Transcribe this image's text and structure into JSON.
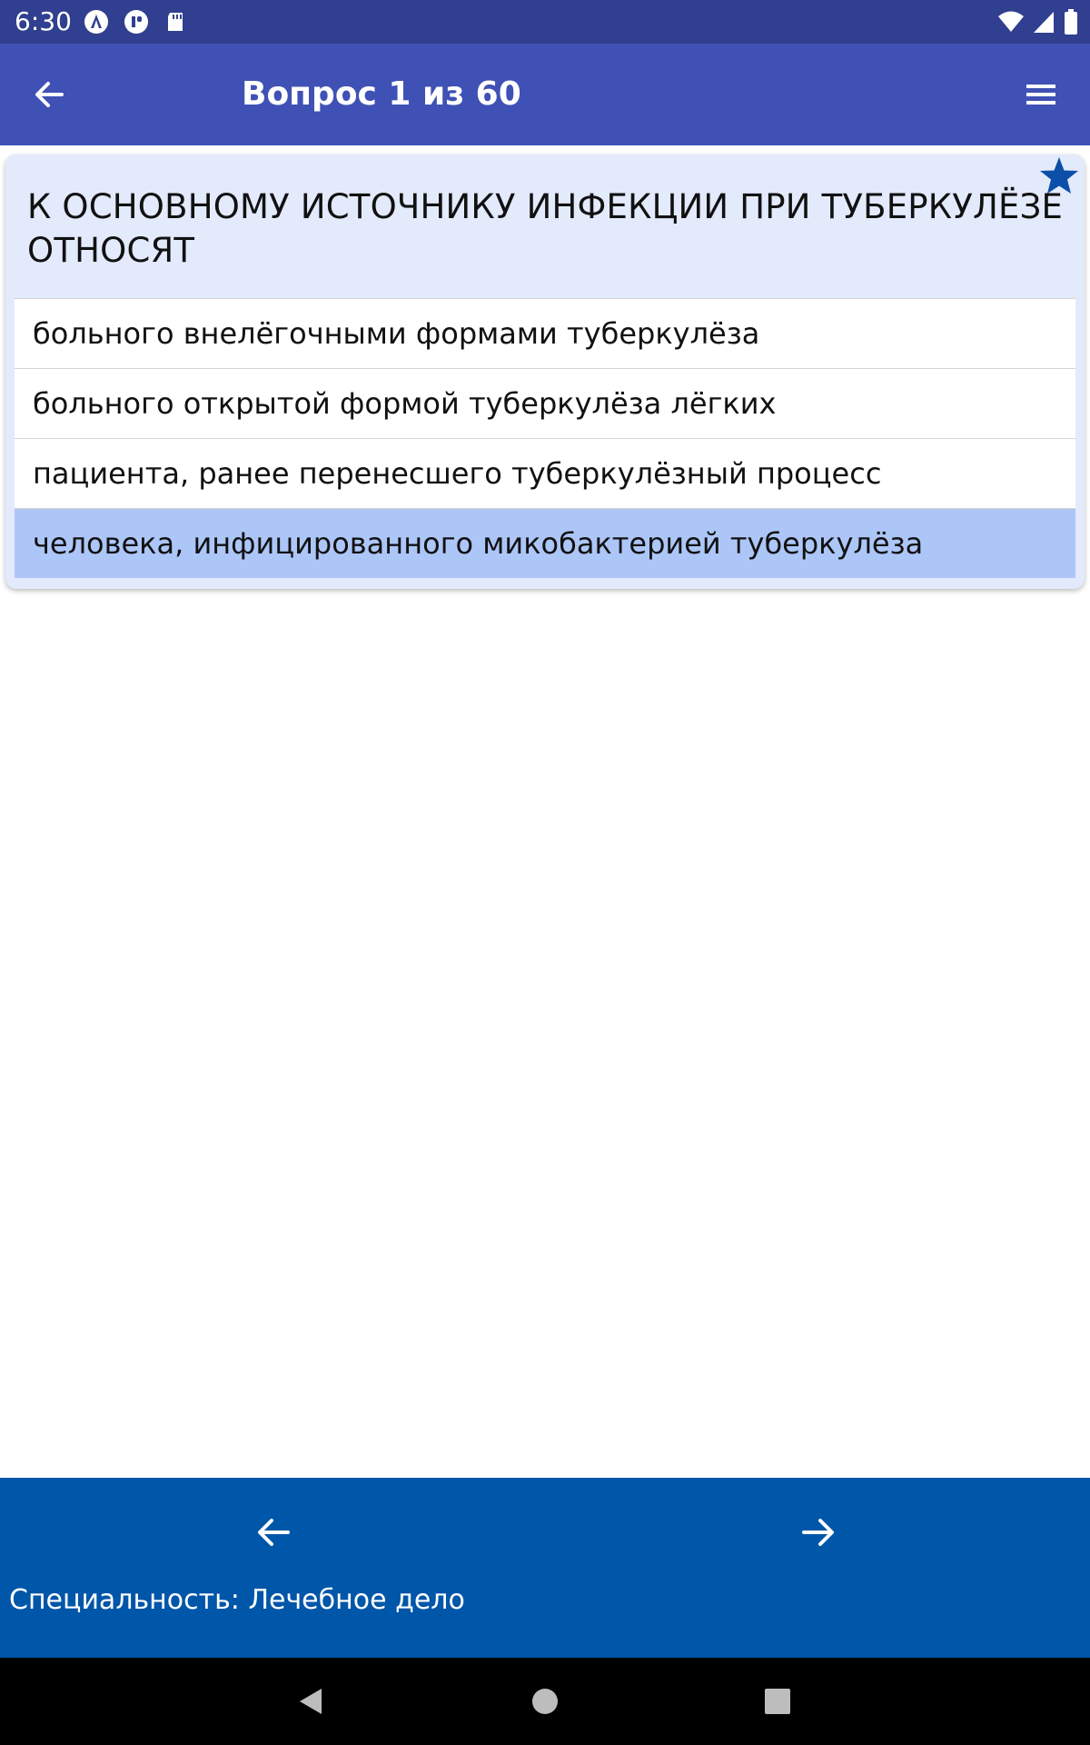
{
  "status_bar": {
    "time": "6:30",
    "icons": [
      "android-auto-icon",
      "notification-icon",
      "sd-card-icon"
    ],
    "right_icons": [
      "wifi-icon",
      "signal-icon",
      "battery-icon"
    ]
  },
  "app_bar": {
    "title": "Вопрос 1 из 60",
    "back_icon": "arrow-left-icon",
    "menu_icon": "hamburger-menu-icon"
  },
  "question": {
    "text": "К ОСНОВНОМУ ИСТОЧНИКУ ИНФЕКЦИИ ПРИ ТУБЕРКУЛЁЗЕ ОТНОСЯТ",
    "favorite_icon": "star-icon",
    "answers": [
      {
        "label": "больного внелёгочными формами туберкулёза",
        "selected": false
      },
      {
        "label": "больного открытой формой туберкулёза лёгких",
        "selected": false
      },
      {
        "label": "пациента, ранее перенесшего туберкулёзный процесс",
        "selected": false
      },
      {
        "label": "человека, инфицированного микобактерией туберкулёза",
        "selected": true
      }
    ]
  },
  "bottom": {
    "prev_icon": "arrow-left-icon",
    "next_icon": "arrow-right-icon",
    "specialty": "Специальность: Лечебное дело"
  },
  "colors": {
    "status_bar": "#303f8f",
    "app_bar": "#3f51b5",
    "card_bg": "#e3eafc",
    "selected_answer": "#adc6f8",
    "bottom_panel": "#0056a8",
    "star": "#0d4fa8"
  }
}
